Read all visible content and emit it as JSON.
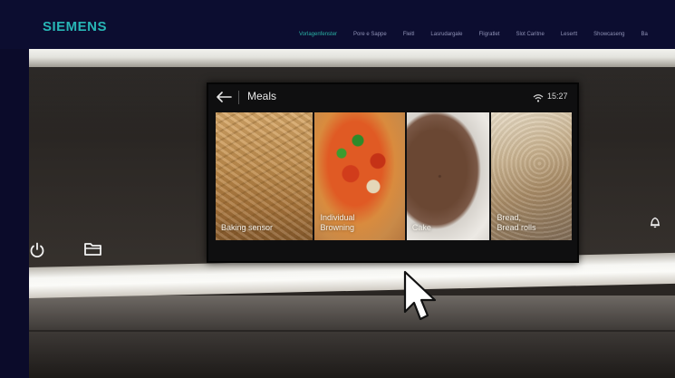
{
  "brand": {
    "name": "SIEMENS",
    "color": "#28b6b6"
  },
  "nav": {
    "items": [
      {
        "label": "Vorlagenfenster",
        "active": true
      },
      {
        "label": "Pore e Sappe",
        "active": false
      },
      {
        "label": "Fleitl",
        "active": false
      },
      {
        "label": "Lasrudargale",
        "active": false
      },
      {
        "label": "Fligratlet",
        "active": false
      },
      {
        "label": "Slot Caritne",
        "active": false
      },
      {
        "label": "Lesertt",
        "active": false
      },
      {
        "label": "Showcaseng",
        "active": false
      },
      {
        "label": "Ba",
        "active": false
      }
    ]
  },
  "screen": {
    "title": "Meals",
    "time": "15:27",
    "tiles": [
      {
        "label": "Baking sensor"
      },
      {
        "label": "Individual\nBrowning"
      },
      {
        "label": "Cake"
      },
      {
        "label": "Bread,\nBread rolls"
      }
    ]
  },
  "icons": {
    "back": "back-arrow-icon",
    "wifi": "wifi-icon",
    "power": "power-icon",
    "folder": "folder-icon",
    "bell": "bell-icon",
    "cursor": "mouse-cursor-icon"
  }
}
